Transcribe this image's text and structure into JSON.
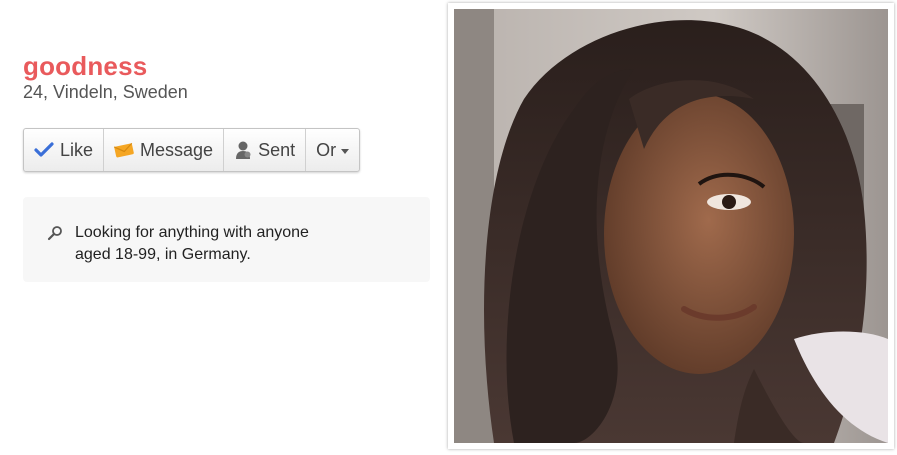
{
  "profile": {
    "name": "goodness",
    "meta": "24, Vindeln, Sweden"
  },
  "actions": {
    "like_label": "Like",
    "message_label": "Message",
    "sent_label": "Sent",
    "or_label": "Or"
  },
  "looking_for": {
    "text": "Looking for anything with anyone aged 18-99, in Germany."
  },
  "icons": {
    "like": "checkmark-icon",
    "message": "envelope-icon",
    "sent": "person-icon",
    "or": "caret-down-icon",
    "looking": "magnifier-icon"
  },
  "colors": {
    "name": "#e95a5c",
    "like_check": "#3a6fd8",
    "message_envelope": "#f5a623"
  }
}
